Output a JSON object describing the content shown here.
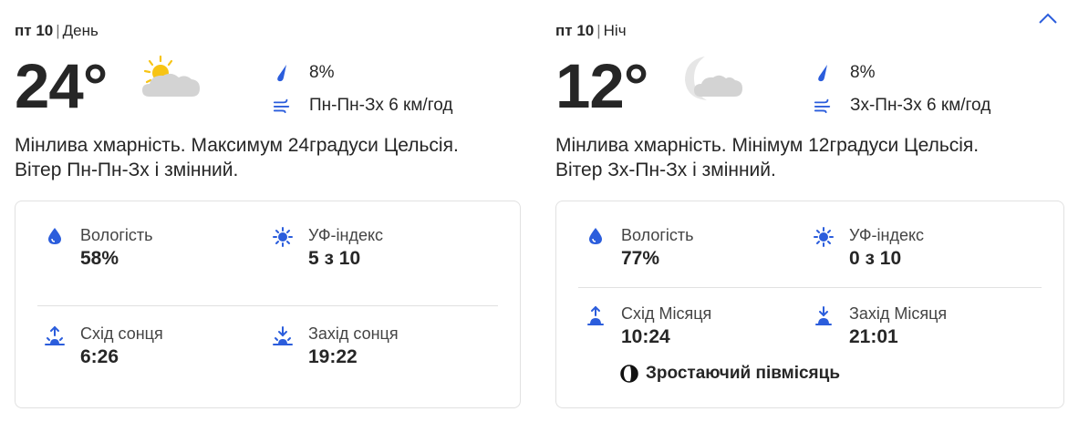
{
  "colors": {
    "accent": "#2b5ddc",
    "text": "#262626",
    "border": "#e1e1e1",
    "sun": "#f7c415",
    "cloud": "#d3d3d3"
  },
  "day": {
    "date": "пт 10",
    "period": "День",
    "temperature": "24°",
    "icon": "partly-cloudy-day-icon",
    "precip": "8%",
    "wind": "Пн-Пн-Зх 6 км/год",
    "description": "Мінлива хмарність. Максимум 24градуси Цельсія. Вітер Пн-Пн-Зх і змінний.",
    "details": {
      "humidity_label": "Вологість",
      "humidity_value": "58%",
      "uv_label": "УФ-індекс",
      "uv_value": "5 з 10",
      "rise_label": "Схід сонця",
      "rise_value": "6:26",
      "set_label": "Захід сонця",
      "set_value": "19:22"
    }
  },
  "night": {
    "date": "пт 10",
    "period": "Ніч",
    "temperature": "12°",
    "icon": "partly-cloudy-night-icon",
    "precip": "8%",
    "wind": "Зх-Пн-Зх 6 км/год",
    "description": "Мінлива хмарність. Мінімум 12градуси Цельсія. Вітер Зх-Пн-Зх і змінний.",
    "details": {
      "humidity_label": "Вологість",
      "humidity_value": "77%",
      "uv_label": "УФ-індекс",
      "uv_value": "0 з 10",
      "rise_label": "Схід Місяця",
      "rise_value": "10:24",
      "set_label": "Захід Місяця",
      "set_value": "21:01",
      "moon_phase": "Зростаючий півмісяць"
    }
  }
}
